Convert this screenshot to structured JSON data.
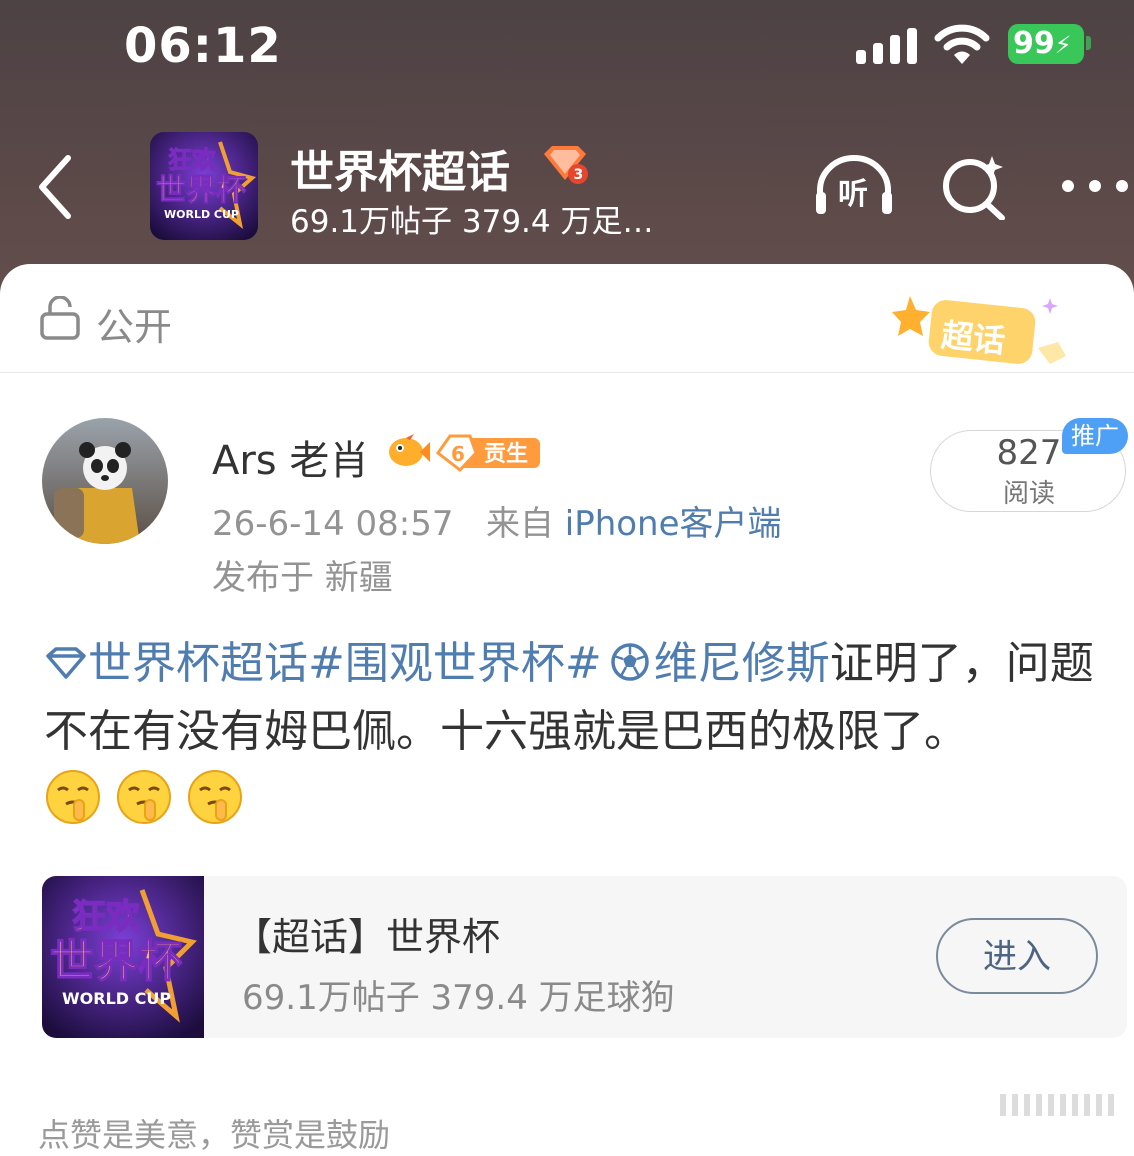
{
  "status_bar": {
    "time": "06:12",
    "battery": "99",
    "signal_icon": "cellular-signal-icon",
    "wifi_icon": "wifi-icon",
    "battery_color": "#39c75a"
  },
  "header": {
    "back_icon": "chevron-left-icon",
    "thumbnail_text": [
      "狂欢",
      "世界杯",
      "WORLD CUP"
    ],
    "title": "世界杯超话",
    "rank_badge": "3",
    "subtitle": "69.1万帖子 379.4 万足…",
    "listen_label": "听",
    "search_icon": "search-sparkle-icon",
    "more_icon": "more-dots-icon"
  },
  "visibility": {
    "label": "公开",
    "lock_icon": "unlocked-lock-icon",
    "sticker_text": "超话"
  },
  "post": {
    "username": "Ars 老肖",
    "level_number": "6",
    "level_label": "贡生",
    "timestamp": "26-6-14 08:57",
    "source_prefix": "来自",
    "source": "iPhone客户端",
    "location": "发布于 新疆",
    "reads_count": "827",
    "reads_label": "阅读",
    "promo_tag": "推广",
    "topic_link": "世界杯超话",
    "hashtag": "#围观世界杯#",
    "mention": "维尼修斯",
    "text_after_mention": "证明了，问题不在有没有姆巴佩。十六强就是巴西的极限了。",
    "emojis": [
      "shush-emoji",
      "shush-emoji",
      "shush-emoji"
    ],
    "link_color": "#507daf"
  },
  "topic_card": {
    "title": "【超话】世界杯",
    "subtitle": "69.1万帖子 379.4 万足球狗",
    "enter_label": "进入"
  },
  "footer": {
    "text": "点赞是美意，赞赏是鼓励"
  }
}
